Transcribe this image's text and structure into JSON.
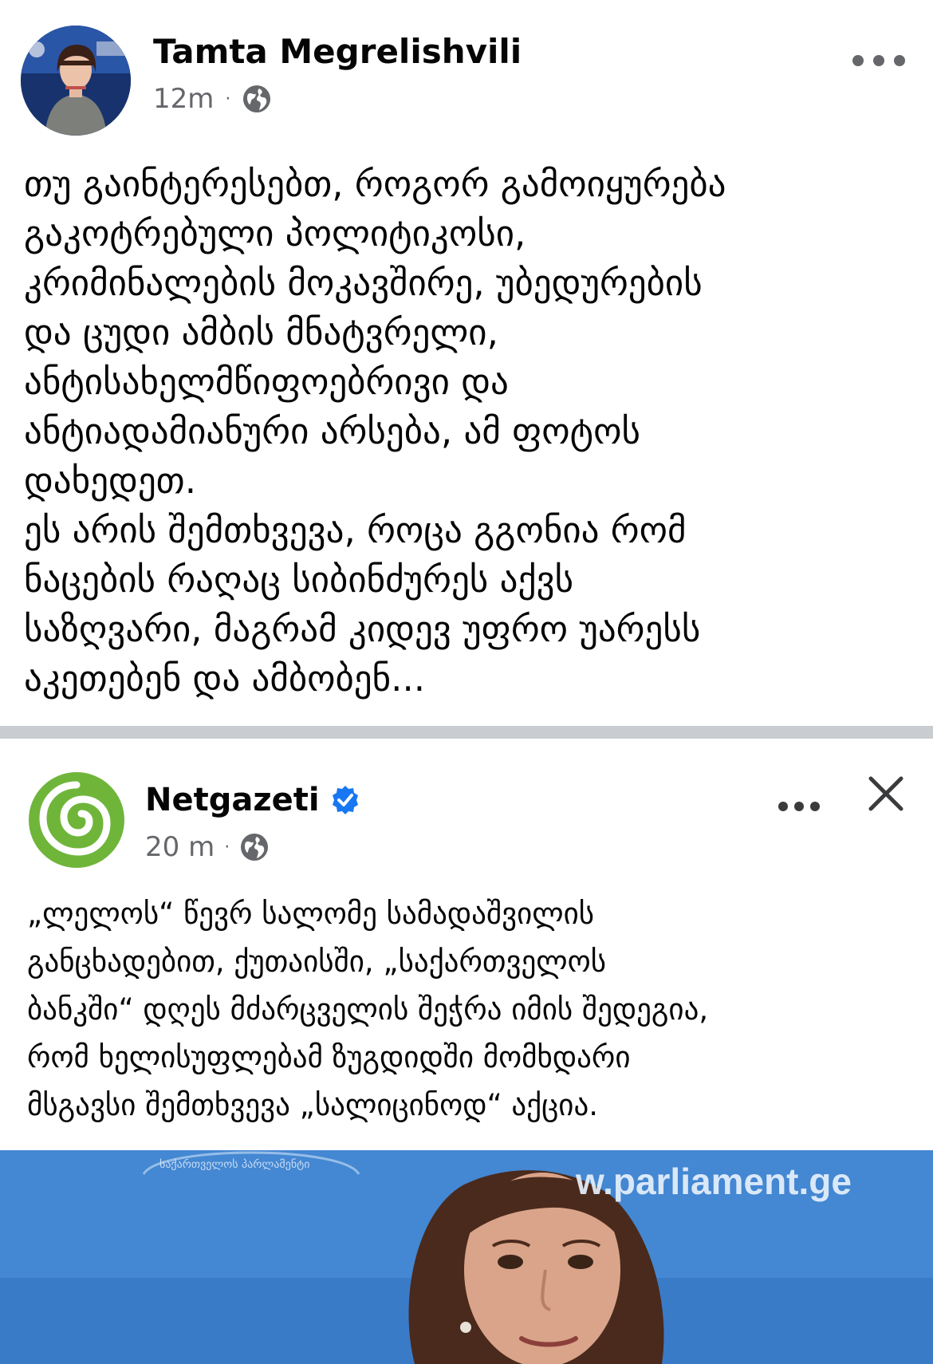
{
  "post": {
    "author": "Tamta Megrelishvili",
    "time": "12m",
    "separator": "·",
    "privacy_icon": "globe-icon",
    "more_icon": "more-horizontal-icon",
    "text": "თუ გაინტერესებთ, როგორ გამოიყურება\nგაკოტრებული პოლიტიკოსი,\nკრიმინალების მოკავშირე, უბედურების\nდა ცუდი ამბის მნატვრელი,\nანტისახელმწიფოებრივი და\nანტიადამიანური არსება, ამ ფოტოს\nდახედეთ.\nეს არის შემთხვევა, როცა გგონია რომ\nნაცების რაღაც სიბინძურეს აქვს\nსაზღვარი, მაგრამ კიდევ უფრო უარესს\nაკეთებენ და ამბობენ..."
  },
  "shared": {
    "page_name": "Netgazeti",
    "verified_icon": "verified-badge-icon",
    "time": "20 m",
    "separator": "·",
    "privacy_icon": "globe-icon",
    "more_icon": "more-horizontal-icon",
    "close_icon": "close-icon",
    "text": "„ლელოს“ წევრ სალომე სამადაშვილის\nგანცხადებით, ქუთაისში, „საქართველოს\nბანკში“ დღეს მძარცველის შეჭრა იმის შედეგია,\nრომ ხელისუფლებამ ზუგდიდში მომხდარი\nმსგავსი შემთხვევა „სალიცინოდ“ აქცია.",
    "photo": {
      "watermark": "w.parliament.ge",
      "seal_text": "საქართველოს პარლამენტი"
    }
  },
  "colors": {
    "text": "#050505",
    "meta": "#65676b",
    "separator": "#c9ccd1",
    "verified": "#1877f2",
    "netgazeti_green": "#6fb53a",
    "photo_bg": "#3f82cf"
  }
}
